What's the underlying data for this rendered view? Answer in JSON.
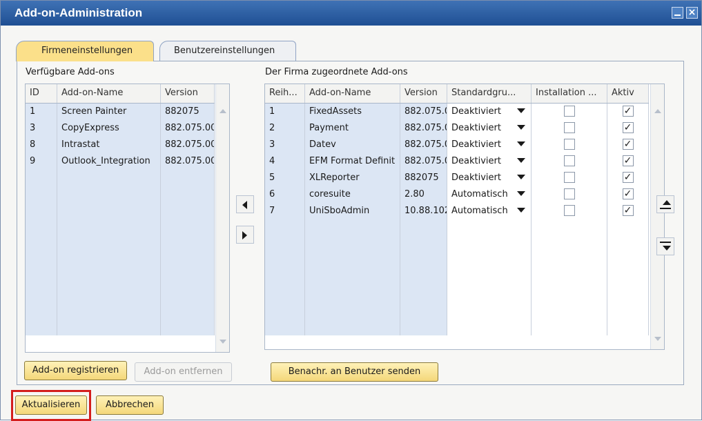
{
  "window": {
    "title": "Add-on-Administration"
  },
  "tabs": [
    {
      "label": "Firmeneinstellungen",
      "active": true
    },
    {
      "label": "Benutzereinstellungen",
      "active": false
    }
  ],
  "available": {
    "heading": "Verfügbare Add-ons",
    "columns": [
      "ID",
      "Add-on-Name",
      "Version"
    ],
    "rows": [
      [
        "1",
        "Screen Painter",
        "882075"
      ],
      [
        "3",
        "CopyExpress",
        "882.075.00."
      ],
      [
        "8",
        "Intrastat",
        "882.075.00."
      ],
      [
        "9",
        "Outlook_Integration",
        "882.075.00."
      ]
    ]
  },
  "assigned": {
    "heading": "Der Firma zugeordnete Add-ons",
    "columns": [
      "Reih...",
      "Add-on-Name",
      "Version",
      "Standardgru...",
      "Installation ...",
      "Aktiv"
    ],
    "rows": [
      [
        "1",
        "FixedAssets",
        "882.075.0",
        "Deaktiviert",
        false,
        true
      ],
      [
        "2",
        "Payment",
        "882.075.0",
        "Deaktiviert",
        false,
        true
      ],
      [
        "3",
        "Datev",
        "882.075.0",
        "Deaktiviert",
        false,
        true
      ],
      [
        "4",
        "EFM Format Definit",
        "882.075.0",
        "Deaktiviert",
        false,
        true
      ],
      [
        "5",
        "XLReporter",
        "882075",
        "Deaktiviert",
        false,
        true
      ],
      [
        "6",
        "coresuite",
        "2.80",
        "Automatisch",
        false,
        true
      ],
      [
        "7",
        "UniSboAdmin",
        "10.88.102",
        "Automatisch",
        false,
        true
      ]
    ]
  },
  "buttons": {
    "register": "Add-on registrieren",
    "remove": "Add-on entfernen",
    "notify": "Benachr. an Benutzer senden",
    "update": "Aktualisieren",
    "cancel": "Abbrechen"
  },
  "colors": {
    "titlebar": "#1f4f93",
    "button": "#f4d77a",
    "highlight": "#d41d1d",
    "rowBlue": "#dce6f4"
  }
}
